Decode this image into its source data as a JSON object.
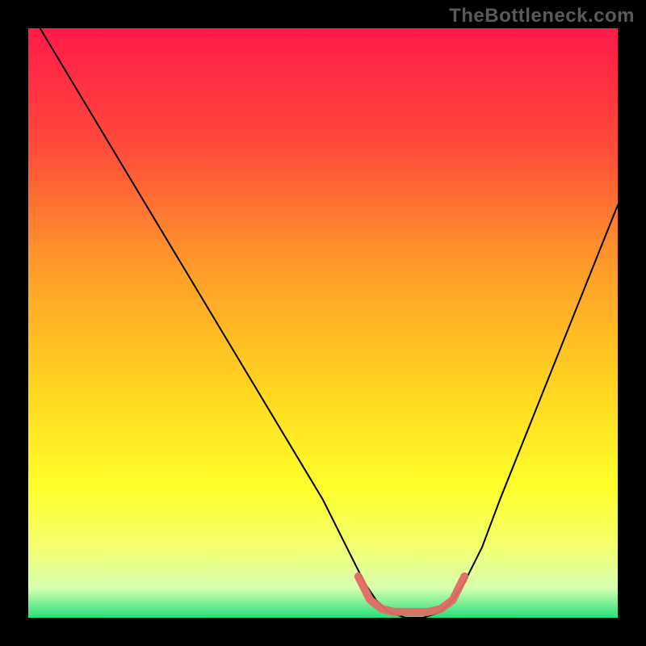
{
  "watermark": "TheBottleneck.com",
  "chart_data": {
    "type": "line",
    "title": "",
    "xlabel": "",
    "ylabel": "",
    "xlim": [
      0,
      100
    ],
    "ylim": [
      0,
      100
    ],
    "background_gradient": [
      {
        "stop": 0.0,
        "color": "#ff1a4a"
      },
      {
        "stop": 0.2,
        "color": "#ff4b3a"
      },
      {
        "stop": 0.4,
        "color": "#ff9a2a"
      },
      {
        "stop": 0.6,
        "color": "#ffd21f"
      },
      {
        "stop": 0.78,
        "color": "#ffff2a"
      },
      {
        "stop": 0.88,
        "color": "#f4ff70"
      },
      {
        "stop": 0.95,
        "color": "#d6ffb0"
      },
      {
        "stop": 1.0,
        "color": "#25e07a"
      }
    ],
    "series": [
      {
        "name": "black-curve",
        "color": "#000000",
        "width": 2,
        "points": [
          {
            "x": 2,
            "y": 100
          },
          {
            "x": 8,
            "y": 90
          },
          {
            "x": 14,
            "y": 80
          },
          {
            "x": 20,
            "y": 70
          },
          {
            "x": 26,
            "y": 60
          },
          {
            "x": 32,
            "y": 50
          },
          {
            "x": 38,
            "y": 40
          },
          {
            "x": 44,
            "y": 30
          },
          {
            "x": 50,
            "y": 20
          },
          {
            "x": 54,
            "y": 12
          },
          {
            "x": 57,
            "y": 6
          },
          {
            "x": 59,
            "y": 3
          },
          {
            "x": 61,
            "y": 1
          },
          {
            "x": 64,
            "y": 0
          },
          {
            "x": 67,
            "y": 0
          },
          {
            "x": 70,
            "y": 1
          },
          {
            "x": 72,
            "y": 3
          },
          {
            "x": 74,
            "y": 6
          },
          {
            "x": 77,
            "y": 12
          },
          {
            "x": 80,
            "y": 20
          },
          {
            "x": 84,
            "y": 30
          },
          {
            "x": 88,
            "y": 40
          },
          {
            "x": 92,
            "y": 50
          },
          {
            "x": 96,
            "y": 60
          },
          {
            "x": 100,
            "y": 70
          }
        ]
      },
      {
        "name": "red-ribbon",
        "color": "#e06a64",
        "width": 10,
        "points": [
          {
            "x": 56,
            "y": 7
          },
          {
            "x": 58,
            "y": 3
          },
          {
            "x": 60,
            "y": 1.5
          },
          {
            "x": 62,
            "y": 1
          },
          {
            "x": 64,
            "y": 1
          },
          {
            "x": 66,
            "y": 1
          },
          {
            "x": 68,
            "y": 1
          },
          {
            "x": 70,
            "y": 1.5
          },
          {
            "x": 72,
            "y": 3
          },
          {
            "x": 74,
            "y": 7
          }
        ]
      }
    ]
  }
}
